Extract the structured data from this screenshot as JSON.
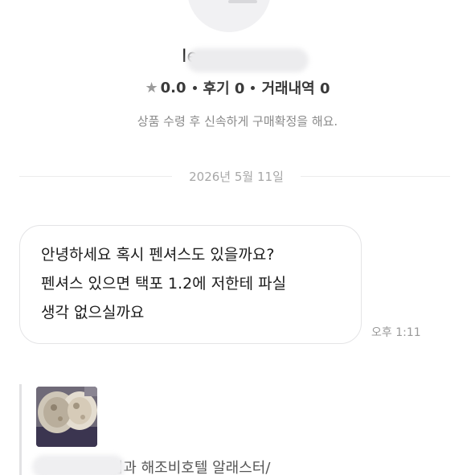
{
  "profile": {
    "nickname": "Ie",
    "stats": {
      "rating": "0.0",
      "reviews_label": "후기 0",
      "transactions_label": "거래내역 0"
    },
    "notice": "상품 수령 후 신속하게 구매확정을 해요."
  },
  "chat": {
    "date_divider": "2026년 5월 11일",
    "messages": [
      {
        "lines": [
          "안녕하세요 혹시 펜셔스도 있을까요?",
          "펜셔스 있으면 택포 1.2에 저한테 파실",
          "생각 없으실까요"
        ],
        "time": "오후 1:11"
      }
    ],
    "quoted_message": {
      "text": "a 님과 해조비호텔 알래스터/"
    }
  },
  "icons": {
    "rating": "star-icon"
  },
  "colors": {
    "muted_text": "#8a8a8a",
    "bubble_border": "#e4e4e6",
    "divider": "#ececec"
  }
}
